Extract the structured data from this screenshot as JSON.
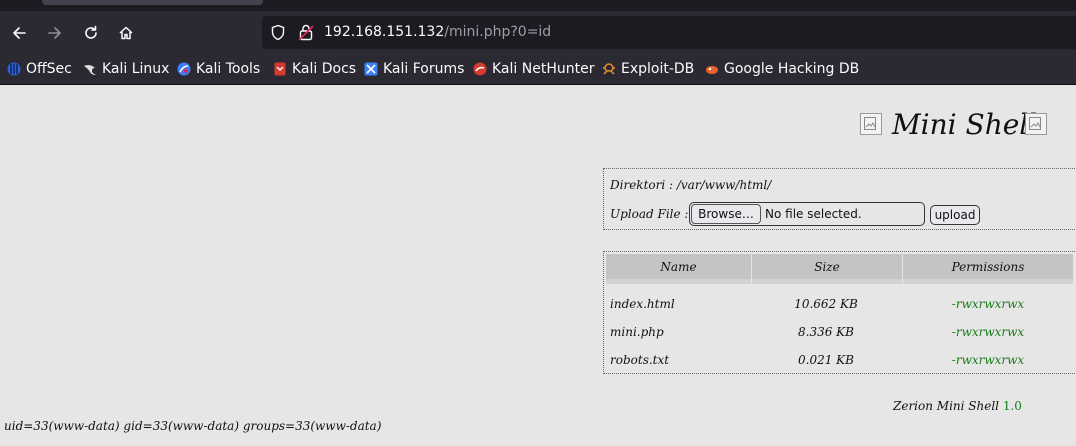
{
  "browser": {
    "url_host": "192.168.151.132",
    "url_path": "/mini.php?0=id",
    "bookmarks": [
      {
        "label": "OffSec",
        "icon": "offsec-icon",
        "color": "#2f62d6"
      },
      {
        "label": "Kali Linux",
        "icon": "kali-dragon-icon",
        "color": "#dddddd"
      },
      {
        "label": "Kali Tools",
        "icon": "kali-tools-icon",
        "color": "#3d7ff5"
      },
      {
        "label": "Kali Docs",
        "icon": "kali-docs-icon",
        "color": "#d63a2f"
      },
      {
        "label": "Kali Forums",
        "icon": "kali-forums-icon",
        "color": "#3d7ff5"
      },
      {
        "label": "Kali NetHunter",
        "icon": "nethunter-icon",
        "color": "#d63a2f"
      },
      {
        "label": "Exploit-DB",
        "icon": "exploit-db-icon",
        "color": "#e8922e"
      },
      {
        "label": "Google Hacking DB",
        "icon": "ghdb-icon",
        "color": "#e8622e"
      }
    ]
  },
  "page": {
    "title": "Mini Shell",
    "directory_label": "Direktori : /var/www/html/",
    "upload_label": "Upload File :",
    "browse_label": "Browse…",
    "no_file_label": "No file selected.",
    "upload_button": "upload",
    "table": {
      "headers": [
        "Name",
        "Size",
        "Permissions"
      ],
      "rows": [
        {
          "name": "index.html",
          "size": "10.662 KB",
          "perm": "-rwxrwxrwx"
        },
        {
          "name": "mini.php",
          "size": "8.336 KB",
          "perm": "-rwxrwxrwx"
        },
        {
          "name": "robots.txt",
          "size": "0.021 KB",
          "perm": "-rwxrwxrwx"
        }
      ]
    },
    "footer_text": "Zerion Mini Shell",
    "footer_version": "1.0",
    "uid_output": "uid=33(www-data) gid=33(www-data) groups=33(www-data)"
  },
  "colors": {
    "permission": "#1a7a1a",
    "page_bg": "#e6e6e6",
    "toolbar_bg": "#2b2a33"
  }
}
